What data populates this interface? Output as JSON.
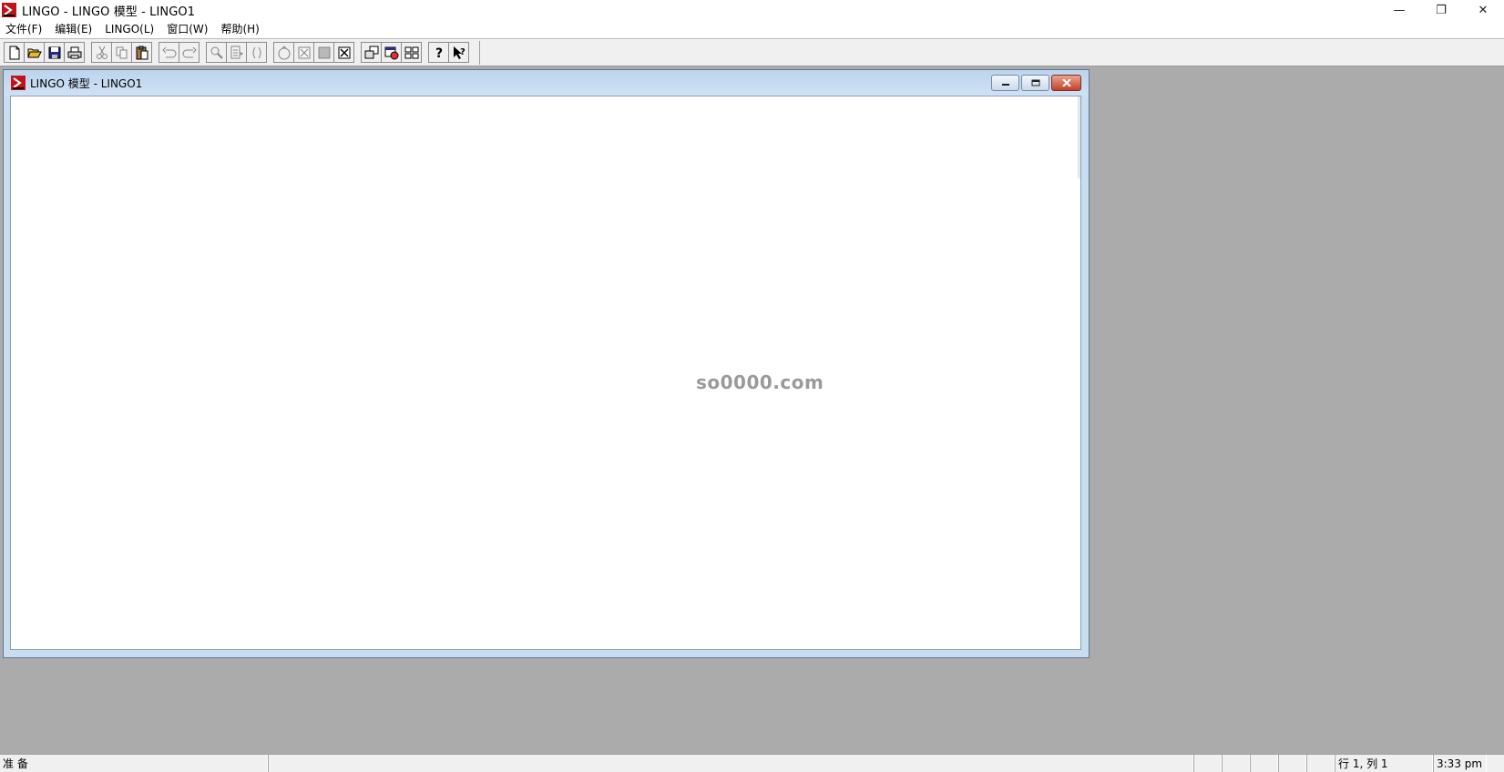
{
  "window": {
    "title": "LINGO - LINGO 模型  - LINGO1",
    "minimize_glyph": "—",
    "restore_glyph": "❐",
    "close_glyph": "✕"
  },
  "menu": {
    "items": [
      {
        "label": "文件(F)"
      },
      {
        "label": "编辑(E)"
      },
      {
        "label": "LINGO(L)"
      },
      {
        "label": "窗口(W)"
      },
      {
        "label": "帮助(H)"
      }
    ]
  },
  "toolbar": {
    "buttons": [
      "new-icon",
      "open-icon",
      "save-icon",
      "print-icon",
      "cut-icon",
      "copy-icon",
      "paste-icon",
      "undo-icon",
      "redo-icon",
      "find-icon",
      "goto-icon",
      "match-parenthesis-icon",
      "solve-icon",
      "solution-icon",
      "picture-icon",
      "close-all-icon",
      "send-to-back-icon",
      "options-icon",
      "tile-icon",
      "help-icon",
      "context-help-icon"
    ]
  },
  "child_window": {
    "title": "LINGO 模型  - LINGO1",
    "editor_content": ""
  },
  "watermark": "so0000.com",
  "status": {
    "ready": "准 备",
    "position": "行 1,  列 1",
    "time": "3:33 pm"
  },
  "colors": {
    "app_icon_red": "#c0141c",
    "mdi_background": "#ababab",
    "child_frame": "#c9ddf0"
  }
}
